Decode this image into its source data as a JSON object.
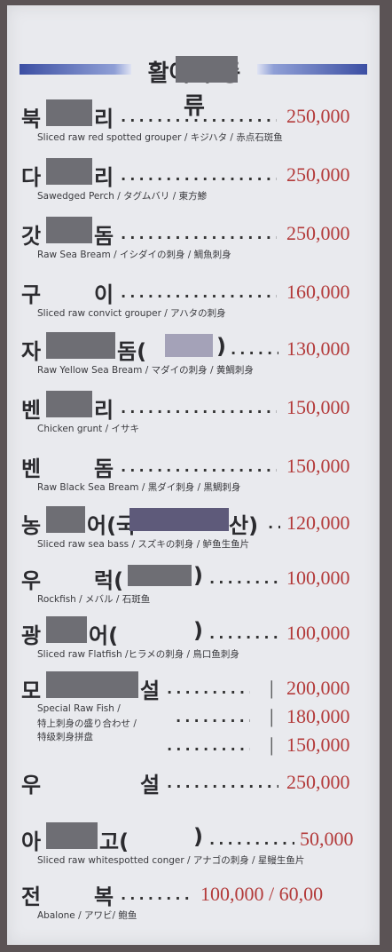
{
  "menu": {
    "title": "활어회 종류",
    "items": [
      {
        "name_left": "북",
        "name_right": "리",
        "price": "250,000",
        "sub": "Sliced raw red spotted grouper / キジハタ / 赤点石斑鱼"
      },
      {
        "name_left": "다",
        "name_right": "리",
        "price": "250,000",
        "sub": "Sawedged Perch / タグムバリ / 東方鯵"
      },
      {
        "name_left": "갓",
        "name_right": "돔",
        "price": "250,000",
        "sub": "Raw Sea Bream / イシダイの刺身 / 鯛魚刺身"
      },
      {
        "name_left": "구",
        "name_right": "이",
        "price": "160,000",
        "sub": "Sliced raw convict grouper / アハタの刺身"
      },
      {
        "name_left": "자",
        "name_right": "돔(",
        "name_tail": ")",
        "price": "130,000",
        "sub": "Raw Yellow Sea Bream / マダイの刺身 / 黄鯛刺身"
      },
      {
        "name_left": "벤",
        "name_right": "리",
        "price": "150,000",
        "sub": "Chicken grunt / イサキ"
      },
      {
        "name_left": "벤",
        "name_right": "돔",
        "price": "150,000",
        "sub": "Raw Black Sea Bream /  黒ダイ刺身 / 黒鯛刺身"
      },
      {
        "name_left": "농",
        "name_right": "어(국",
        "name_tail": "산)",
        "price": "120,000",
        "sub": "Sliced raw sea bass / スズキの刺身 / 鲈鱼生鱼片"
      },
      {
        "name_left": "우",
        "name_right": "럭(",
        "name_tail": ")",
        "price": "100,000",
        "sub": "Rockfish / メバル / 石斑鱼"
      },
      {
        "name_left": "광",
        "name_right": "어(",
        "name_tail": ")",
        "price": "100,000",
        "sub": "Sliced raw Flatfish /ヒラメの刺身 / 鳥口鱼刺身"
      },
      {
        "name_left": "모",
        "name_right": "설",
        "price": "200,000",
        "price2": "180,000",
        "price3": "150,000",
        "sub": "Special Raw Fish /",
        "sub2": "特上刺身の盛り合わせ /",
        "sub3": "特级刺身拼盘"
      },
      {
        "name_left": "우",
        "name_right": "설",
        "price": "250,000",
        "sub": ""
      },
      {
        "name_left": "아",
        "name_right": "고(",
        "name_tail": ")",
        "price": "50,000",
        "sub": "Sliced raw whitespotted conger / アナゴの刺身 / 星鳗生鱼片"
      },
      {
        "name_left": "전",
        "name_right": "복",
        "price": "100,000 / 60,00",
        "sub": "Abalone / アワビ/ 鲍鱼"
      }
    ]
  }
}
